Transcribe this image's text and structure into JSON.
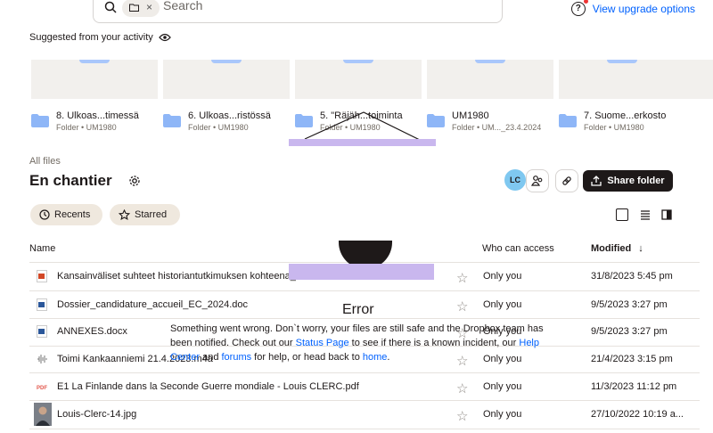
{
  "search": {
    "placeholder": "Search"
  },
  "header": {
    "upgrade_link": "View upgrade options"
  },
  "suggested": {
    "title": "Suggested from your activity",
    "items": [
      {
        "name": "8. Ulkoas...timessä",
        "meta": "Folder • UM1980"
      },
      {
        "name": "6. Ulkoas...ristössä",
        "meta": "Folder • UM1980"
      },
      {
        "name": "5. \"Räjäh...toiminta",
        "meta": "Folder • UM1980"
      },
      {
        "name": "UM1980",
        "meta": "Folder • UM..._23.4.2024"
      },
      {
        "name": "7. Suome...erkosto",
        "meta": "Folder • UM1980"
      }
    ]
  },
  "breadcrumb": "All files",
  "page_title": "En chantier",
  "avatar_initials": "LC",
  "share_button": "Share folder",
  "filters": {
    "recents": "Recents",
    "starred": "Starred"
  },
  "table": {
    "col_name": "Name",
    "col_access": "Who can access",
    "col_modified": "Modified",
    "rows": [
      {
        "icon": "pptx-icon",
        "name": "Kansainväliset suhteet historiantutkimuksen kohteena_...",
        "access": "Only you",
        "modified": "31/8/2023 5:45 pm"
      },
      {
        "icon": "word-doc-icon",
        "name": "Dossier_candidature_accueil_EC_2024.doc",
        "access": "Only you",
        "modified": "9/5/2023 3:27 pm"
      },
      {
        "icon": "word-doc-icon",
        "name": "ANNEXES.docx",
        "access": "Only you",
        "modified": "9/5/2023 3:27 pm"
      },
      {
        "icon": "audio-file-icon",
        "name": "Toimi Kankaanniemi 21.4.2023.m4a",
        "access": "Only you",
        "modified": "21/4/2023 3:15 pm"
      },
      {
        "icon": "pdf-icon",
        "name": "E1 La Finlande dans la Seconde Guerre mondiale - Louis CLERC.pdf",
        "access": "Only you",
        "modified": "11/3/2023 11:12 pm"
      },
      {
        "icon": "photo-thumbnail-icon",
        "name": "Louis-Clerc-14.jpg",
        "access": "Only you",
        "modified": "27/10/2022 10:19 a..."
      }
    ]
  },
  "error": {
    "title": "Error",
    "text1": "Something went wrong. Don`t worry, your files are still safe and the Dropbox team has been notified. Check out our ",
    "link_status": "Status Page",
    "text2": " to see if there is a known incident, our ",
    "link_help": "Help Center",
    "text3": " and ",
    "link_forums": "forums",
    "text4": " for help, or head back to ",
    "link_home": "home",
    "text5": "."
  },
  "colors": {
    "accent": "#0061fe",
    "dark": "#1e1919",
    "overlay": "#c9b7ee",
    "avatar": "#7fc8f0"
  }
}
